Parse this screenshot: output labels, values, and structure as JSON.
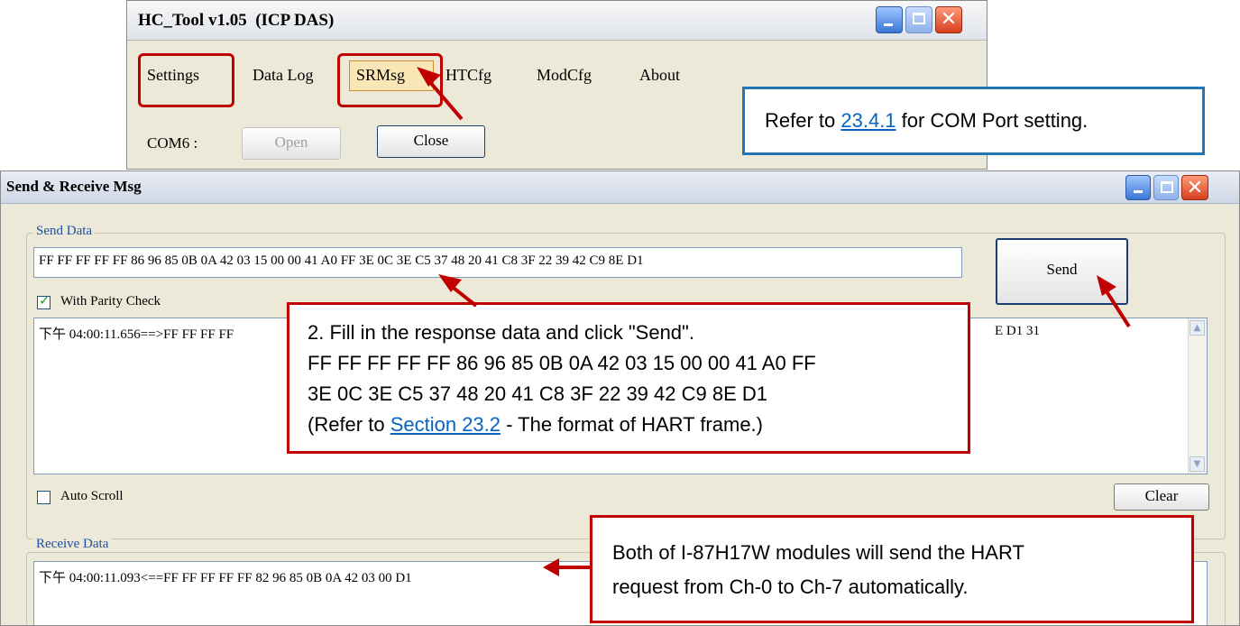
{
  "hc_tool": {
    "title": "HC_Tool v1.05  (ICP DAS)",
    "menu": [
      "Settings",
      "Data Log",
      "SRMsg",
      "HTCfg",
      "ModCfg",
      "About"
    ],
    "com_label": "COM6 :",
    "open_label": "Open",
    "close_label": "Close"
  },
  "sr_window": {
    "title": "Send & Receive Msg",
    "send_group_label": "Send Data",
    "send_input_value": "FF FF FF FF FF 86 96 85 0B 0A 42 03 15 00 00 41 A0 FF 3E 0C 3E C5 37 48 20 41 C8 3F 22 39 42 C9 8E D1",
    "send_button": "Send",
    "parity_label": "With Parity Check",
    "send_log_left": "下午 04:00:11.656==>FF FF FF FF",
    "send_log_right": "E D1 31",
    "auto_scroll_label": "Auto Scroll",
    "clear_button": "Clear",
    "receive_group_label": "Receive Data",
    "receive_log": "下午 04:00:11.093<==FF FF FF FF FF 82 96 85 0B 0A 42 03 00 D1"
  },
  "annotations": {
    "com_note_prefix": "Refer to ",
    "com_note_link": "23.4.1",
    "com_note_suffix": " for COM Port setting.",
    "fill_line1": "2. Fill in the response data and click \"Send\".",
    "fill_line2": "FF FF FF FF FF 86 96 85 0B 0A 42 03 15 00 00 41 A0 FF",
    "fill_line3": "3E 0C 3E C5 37 48 20 41 C8 3F 22 39 42 C9 8E D1",
    "fill_line4_prefix": "(Refer to ",
    "fill_line4_link": "Section 23.2",
    "fill_line4_suffix": " - The format of HART frame.)",
    "modules_line1": "Both of I-87H17W modules will send the HART",
    "modules_line2": "request from Ch-0 to Ch-7 automatically."
  },
  "colors": {
    "annotation_red": "#c00000",
    "callout_blue": "#1f77b4",
    "link_blue": "#0563c1"
  }
}
